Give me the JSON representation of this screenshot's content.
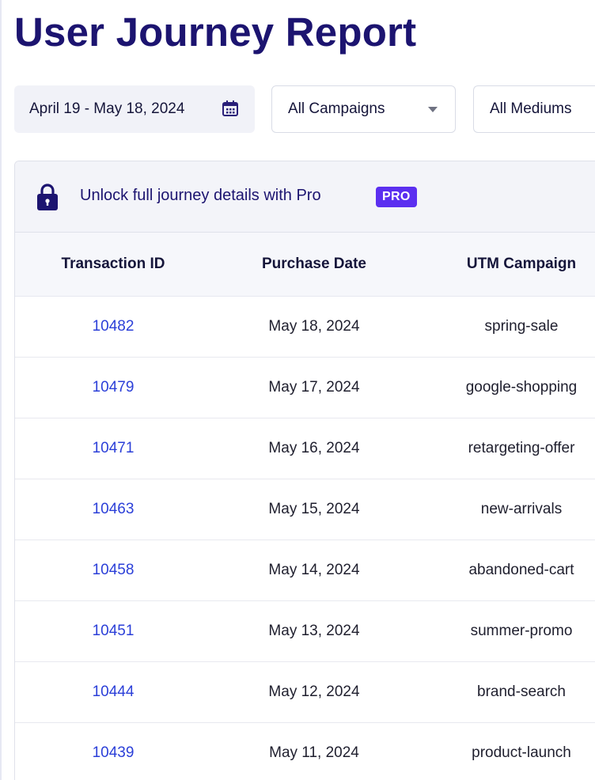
{
  "page": {
    "title": "User Journey Report"
  },
  "filters": {
    "date_range": "April 19 - May 18, 2024",
    "campaign": "All Campaigns",
    "medium": "All Mediums"
  },
  "banner": {
    "text": "Unlock full journey details with Pro",
    "badge": "PRO",
    "badge_color": "#5b2ff0"
  },
  "table": {
    "columns": [
      "Transaction ID",
      "Purchase Date",
      "UTM Campaign"
    ],
    "rows": [
      {
        "id": "10482",
        "date": "May 18, 2024",
        "campaign": "spring-sale"
      },
      {
        "id": "10479",
        "date": "May 17, 2024",
        "campaign": "google-shopping"
      },
      {
        "id": "10471",
        "date": "May 16, 2024",
        "campaign": "retargeting-offer"
      },
      {
        "id": "10463",
        "date": "May 15, 2024",
        "campaign": "new-arrivals"
      },
      {
        "id": "10458",
        "date": "May 14, 2024",
        "campaign": "abandoned-cart"
      },
      {
        "id": "10451",
        "date": "May 13, 2024",
        "campaign": "summer-promo"
      },
      {
        "id": "10444",
        "date": "May 12, 2024",
        "campaign": "brand-search"
      },
      {
        "id": "10439",
        "date": "May 11, 2024",
        "campaign": "product-launch"
      }
    ]
  },
  "colors": {
    "title": "#1c1470",
    "link": "#2b3fd8"
  },
  "icons": {
    "date": "calendar-icon",
    "select": "caret-down-icon",
    "banner": "lock-icon"
  }
}
